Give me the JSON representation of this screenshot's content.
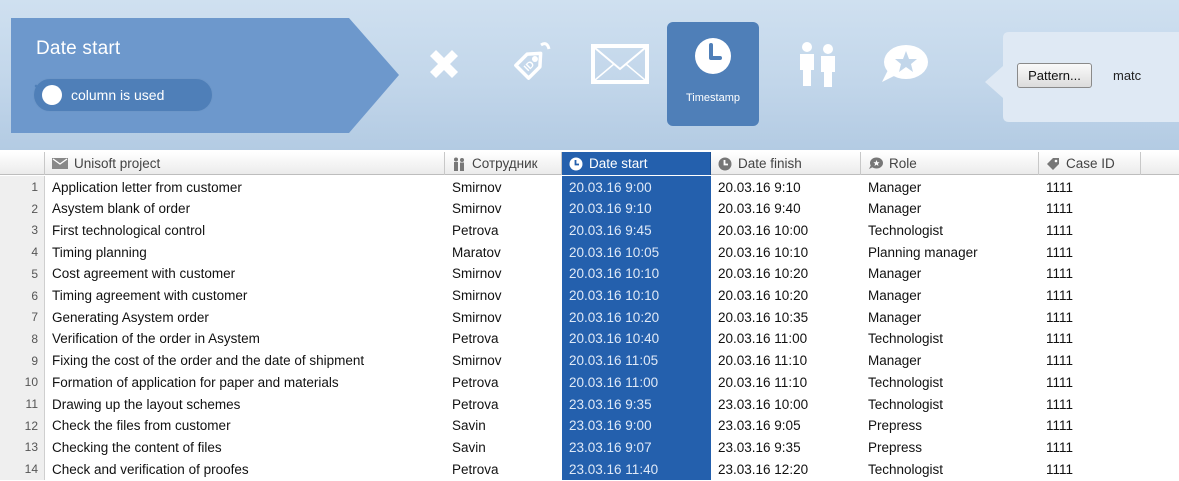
{
  "toolbar": {
    "column_title": "Date start",
    "column_used_label": "column is used",
    "active_tool_label": "Timestamp",
    "pattern_button": "Pattern...",
    "pattern_text": "matc"
  },
  "colors": {
    "accent": "#2460ad",
    "panel": "#6d98cc",
    "toolbar_bg": "#c2d6ea"
  },
  "icons": [
    "delete-icon",
    "tag-id-icon",
    "envelope-icon",
    "clock-icon",
    "users-icon",
    "star-chat-icon"
  ],
  "table": {
    "headers": [
      "Unisoft project",
      "Сотрудник",
      "Date start",
      "Date finish",
      "Role",
      "Case ID"
    ],
    "rows": [
      {
        "n": "1",
        "project": "Application letter from customer",
        "employee": "Smirnov",
        "start": "20.03.16 9:00",
        "finish": "20.03.16 9:10",
        "role": "Manager",
        "case": "1111"
      },
      {
        "n": "2",
        "project": "Asystem blank of order",
        "employee": "Smirnov",
        "start": "20.03.16 9:10",
        "finish": "20.03.16 9:40",
        "role": "Manager",
        "case": "1111"
      },
      {
        "n": "3",
        "project": "First technological control",
        "employee": "Petrova",
        "start": "20.03.16 9:45",
        "finish": "20.03.16 10:00",
        "role": "Technologist",
        "case": "1111"
      },
      {
        "n": "4",
        "project": "Timing planning",
        "employee": "Maratov",
        "start": "20.03.16 10:05",
        "finish": "20.03.16 10:10",
        "role": "Planning manager",
        "case": "1111"
      },
      {
        "n": "5",
        "project": "Cost agreement with customer",
        "employee": "Smirnov",
        "start": "20.03.16 10:10",
        "finish": "20.03.16 10:20",
        "role": "Manager",
        "case": "1111"
      },
      {
        "n": "6",
        "project": "Timing agreement with customer",
        "employee": "Smirnov",
        "start": "20.03.16 10:10",
        "finish": "20.03.16 10:20",
        "role": "Manager",
        "case": "1111"
      },
      {
        "n": "7",
        "project": "Generating Asystem order",
        "employee": "Smirnov",
        "start": "20.03.16 10:20",
        "finish": "20.03.16 10:35",
        "role": "Manager",
        "case": "1111"
      },
      {
        "n": "8",
        "project": "Verification of the order in Asystem",
        "employee": "Petrova",
        "start": "20.03.16 10:40",
        "finish": "20.03.16 11:00",
        "role": "Technologist",
        "case": "1111"
      },
      {
        "n": "9",
        "project": "Fixing the cost of the order and the date of shipment",
        "employee": "Smirnov",
        "start": "20.03.16 11:05",
        "finish": "20.03.16 11:10",
        "role": "Manager",
        "case": "1111"
      },
      {
        "n": "10",
        "project": "Formation of application for paper and materials",
        "employee": "Petrova",
        "start": "20.03.16 11:00",
        "finish": "20.03.16 11:10",
        "role": "Technologist",
        "case": "1111"
      },
      {
        "n": "11",
        "project": "Drawing up the layout schemes",
        "employee": "Petrova",
        "start": "23.03.16 9:35",
        "finish": "23.03.16 10:00",
        "role": "Technologist",
        "case": "1111"
      },
      {
        "n": "12",
        "project": "Check the files from customer",
        "employee": "Savin",
        "start": "23.03.16 9:00",
        "finish": "23.03.16 9:05",
        "role": "Prepress",
        "case": "1111"
      },
      {
        "n": "13",
        "project": "Checking the content of files",
        "employee": "Savin",
        "start": "23.03.16 9:07",
        "finish": "23.03.16 9:35",
        "role": "Prepress",
        "case": "1111"
      },
      {
        "n": "14",
        "project": "Check and verification of proofes",
        "employee": "Petrova",
        "start": "23.03.16 11:40",
        "finish": "23.03.16 12:20",
        "role": "Technologist",
        "case": "1111"
      }
    ]
  }
}
